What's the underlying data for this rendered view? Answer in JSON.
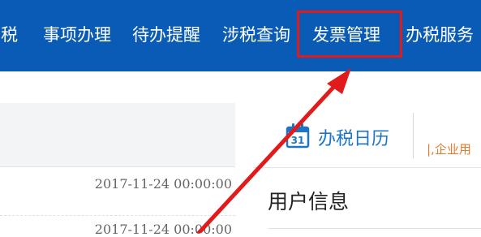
{
  "nav": {
    "items": [
      {
        "label": "纳税"
      },
      {
        "label": "事项办理"
      },
      {
        "label": "待办提醒"
      },
      {
        "label": "涉税查询"
      },
      {
        "label": "发票管理"
      },
      {
        "label": "办税服务"
      }
    ]
  },
  "left_list": {
    "rows": [
      {
        "date": "2017-11-24 00:00:00"
      },
      {
        "date": "2017-11-24 00:00:00"
      }
    ]
  },
  "right": {
    "calendar_tab_label": "办税日历",
    "calendar_icon_day": "31",
    "scroll_notice": "|,企业用",
    "section_title": "用户信息"
  },
  "colors": {
    "nav_bg": "#0a5bb5",
    "highlight_border": "#e11b1b",
    "arrow": "#e11b1b",
    "tab_text": "#1c74c7",
    "notice_text": "#e8792f"
  },
  "icons": {
    "calendar": "calendar-icon",
    "arrow": "annotation-arrow"
  }
}
